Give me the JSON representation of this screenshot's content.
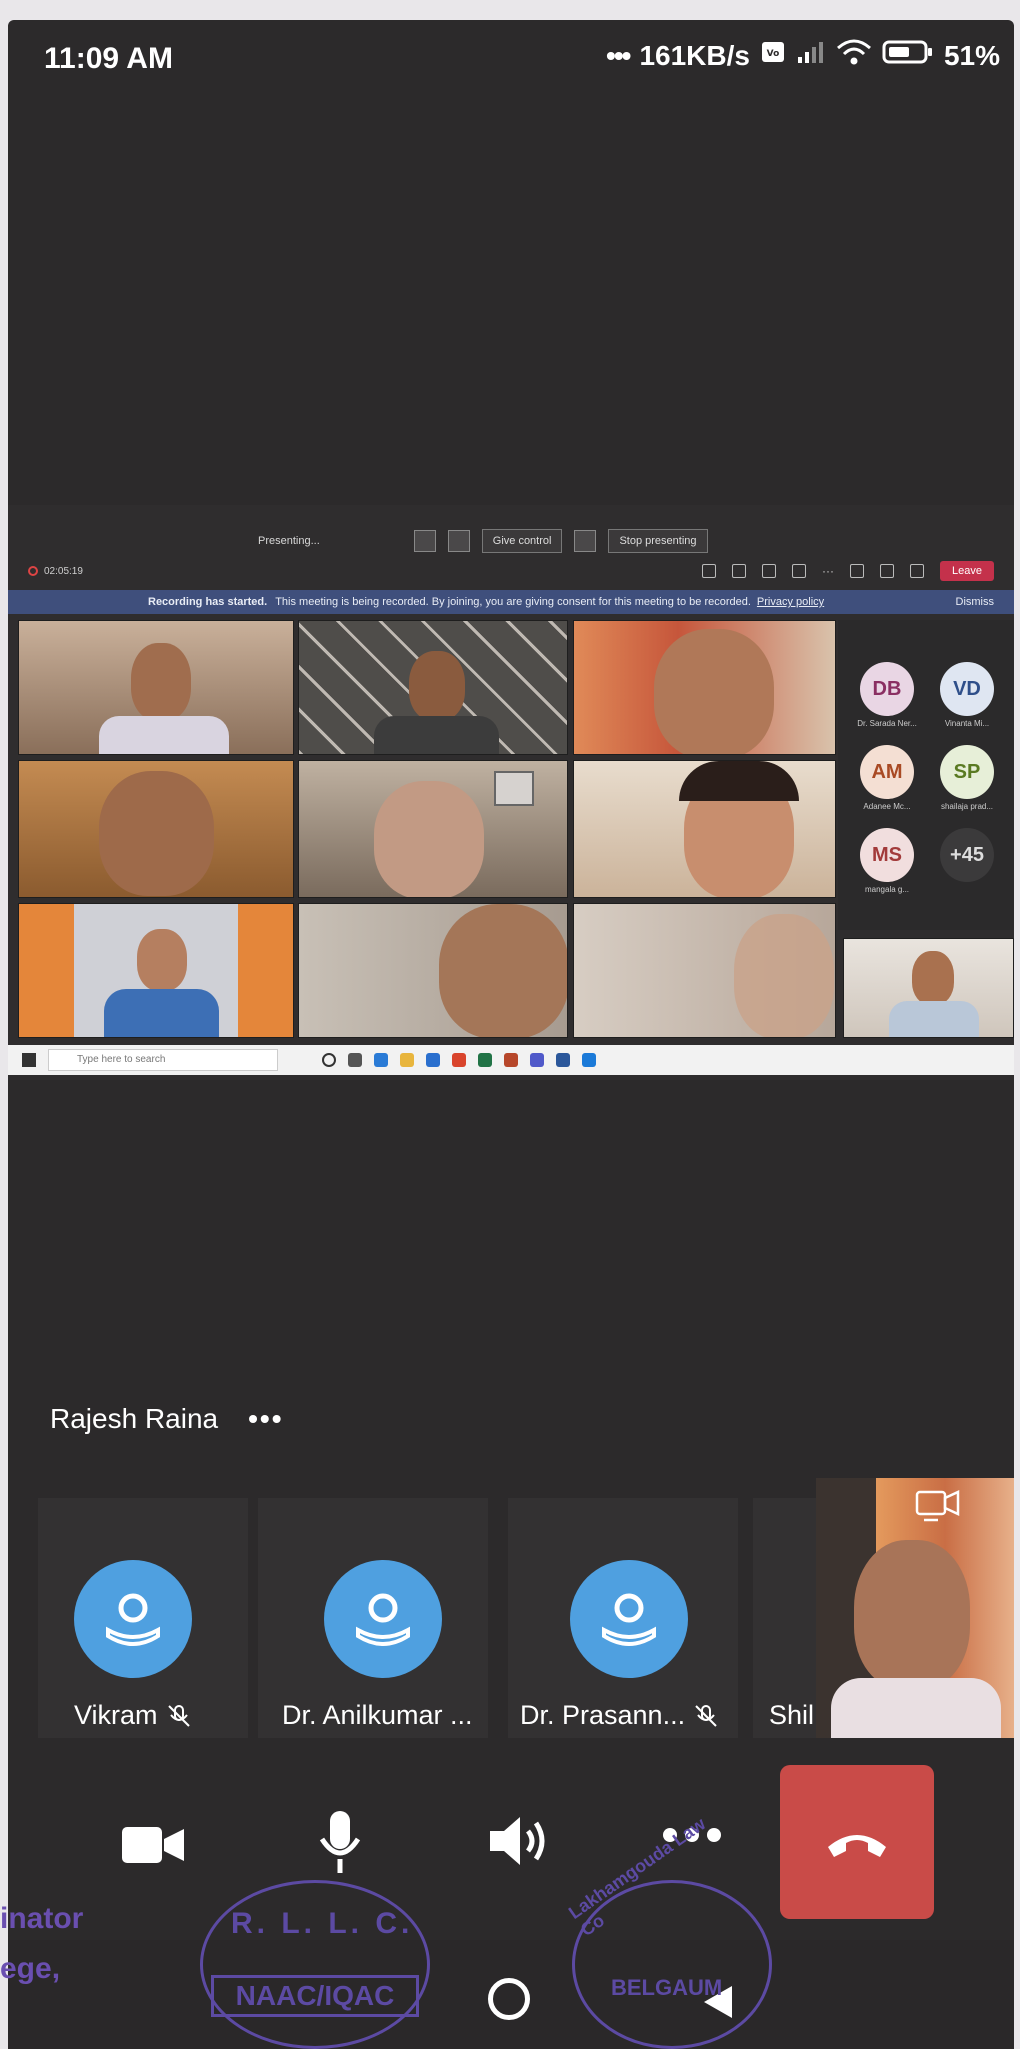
{
  "status_bar": {
    "time": "11:09 AM",
    "speed": "161KB/s",
    "battery": "51%"
  },
  "shared_screen": {
    "presenting_label": "Presenting...",
    "give_control": "Give control",
    "stop_presenting": "Stop presenting",
    "recording_time": "02:05:19",
    "leave": "Leave",
    "banner_title": "Recording has started.",
    "banner_text": "This meeting is being recorded. By joining, you are giving consent for this meeting to be recorded.",
    "privacy_link": "Privacy policy",
    "dismiss": "Dismiss",
    "search_placeholder": "Type here to search",
    "avatars": [
      {
        "initials": "DB",
        "label": "Dr. Sarada Ner...",
        "bg": "#e9d6e4",
        "fg": "#8a2f62"
      },
      {
        "initials": "VD",
        "label": "Vinanta Mi...",
        "bg": "#dfe6f2",
        "fg": "#2f4f8a"
      },
      {
        "initials": "AM",
        "label": "Adanee Mc...",
        "bg": "#f4dfd3",
        "fg": "#a94a24"
      },
      {
        "initials": "SP",
        "label": "shailaja prad...",
        "bg": "#e7efd8",
        "fg": "#5a7a22"
      },
      {
        "initials": "MS",
        "label": "mangala g...",
        "bg": "#f1dede",
        "fg": "#a23a3a"
      },
      {
        "initials": "+45",
        "label": "",
        "bg": "#3b3a3b",
        "fg": "#dddddd"
      }
    ]
  },
  "call": {
    "active_speaker": "Rajesh Raina",
    "participants": [
      {
        "name": "Vikram",
        "muted": true
      },
      {
        "name": "Dr. Anilkumar ...",
        "muted": false
      },
      {
        "name": "Dr. Prasann...",
        "muted": true
      },
      {
        "name": "Shil",
        "muted": false
      }
    ]
  },
  "stamp": {
    "text_line1": "inator",
    "text_line2": "ege,",
    "seal1": "R. L. L. C.",
    "seal1_inner": "NAAC/IQAC",
    "seal2": "BELGAUM",
    "seal2_arc": "Lakhamgouda Law Co"
  }
}
